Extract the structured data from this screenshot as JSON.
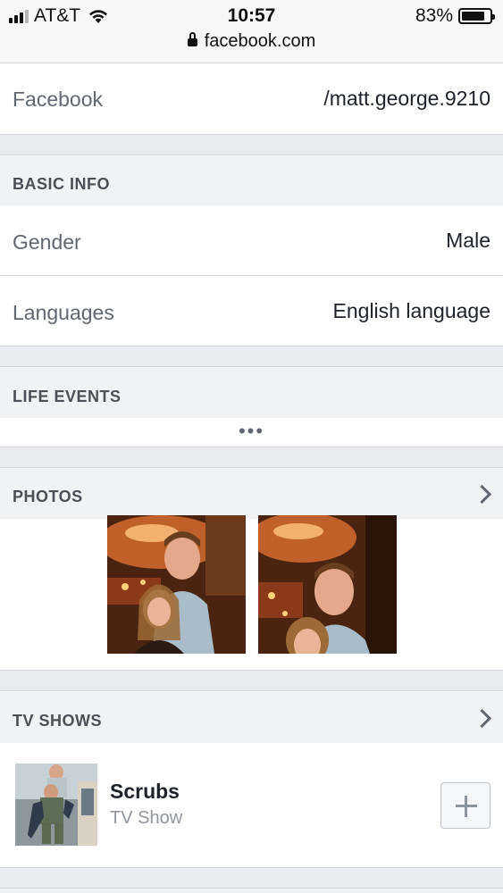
{
  "status_bar": {
    "carrier": "AT&T",
    "time": "10:57",
    "battery": "83%",
    "battery_level": 0.83,
    "url": "facebook.com"
  },
  "contact": {
    "label": "Facebook",
    "value": "/matt.george.9210"
  },
  "basic_info": {
    "title": "BASIC INFO",
    "gender_label": "Gender",
    "gender_value": "Male",
    "languages_label": "Languages",
    "languages_value": "English language"
  },
  "life_events": {
    "title": "LIFE EVENTS",
    "more": "•••"
  },
  "photos": {
    "title": "PHOTOS",
    "icon": "chevron-right-icon"
  },
  "tv_shows": {
    "title": "TV SHOWS",
    "icon": "chevron-right-icon",
    "items": [
      {
        "title": "Scrubs",
        "subtitle": "TV Show",
        "action_icon": "plus-icon"
      }
    ]
  },
  "colors": {
    "background": "#e9ebee",
    "section_header": "#f1f2f4",
    "text_secondary": "#606770"
  }
}
